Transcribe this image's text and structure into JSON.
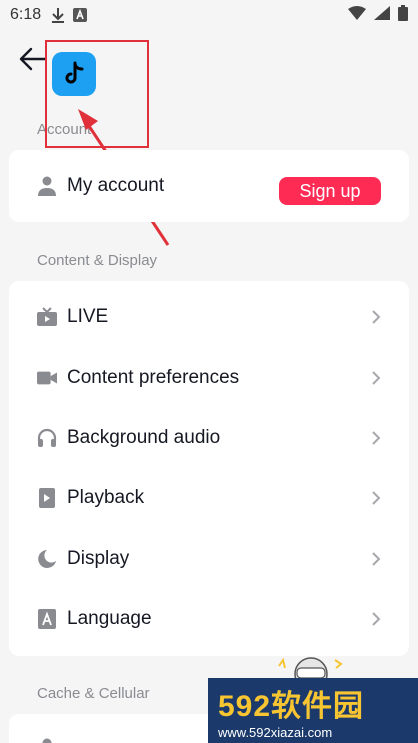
{
  "status_bar": {
    "time": "6:18"
  },
  "header": {
    "logo_label": "TikTok"
  },
  "sections": {
    "account": {
      "title": "Account",
      "items": [
        {
          "label": "My account",
          "button": "Sign up"
        }
      ]
    },
    "content_display": {
      "title": "Content & Display",
      "items": [
        {
          "label": "LIVE"
        },
        {
          "label": "Content preferences"
        },
        {
          "label": "Background audio"
        },
        {
          "label": "Playback"
        },
        {
          "label": "Display"
        },
        {
          "label": "Language"
        }
      ]
    },
    "cache": {
      "title": "Cache & Cellular"
    }
  },
  "watermark": {
    "brand": "592软件园",
    "url": "www.592xiazai.com"
  },
  "colors": {
    "accent": "#fe2c55",
    "annotation": "#e0303a",
    "logo_bg": "#1da0f2"
  }
}
